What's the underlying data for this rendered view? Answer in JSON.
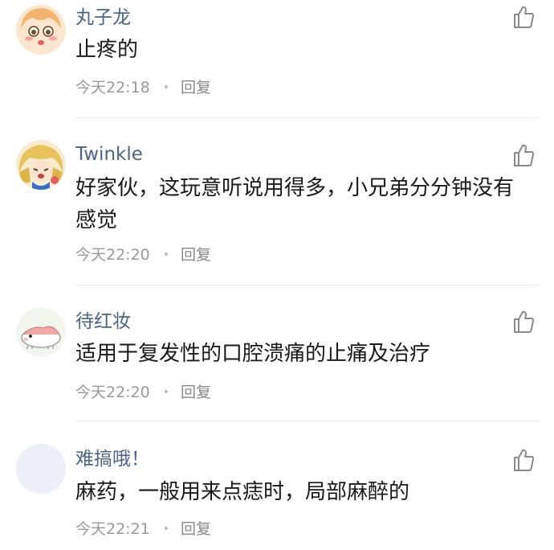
{
  "comments": [
    {
      "name": "丸子龙",
      "text": "止疼的",
      "time": "今天22:18",
      "reply": "回复",
      "avatar": "anime-girl-blush-avatar"
    },
    {
      "name": "Twinkle",
      "text": "好家伙，这玩意听说用得多，小兄弟分分钟没有感觉",
      "time": "今天22:20",
      "reply": "回复",
      "avatar": "anime-blonde-girl-avatar"
    },
    {
      "name": "待红妆",
      "text": "适用于复发性的口腔溃痛的止痛及治疗",
      "time": "今天22:20",
      "reply": "回复",
      "avatar": "hamster-avatar"
    },
    {
      "name": "难搞哦！",
      "text": "麻药，一般用来点痣时，局部麻醉的",
      "time": "今天22:21",
      "reply": "回复",
      "avatar": "default-avatar"
    }
  ],
  "icons": {
    "like": "thumbs-up-icon"
  },
  "colors": {
    "name": "#4a6487",
    "text": "#1a1a1a",
    "meta": "#999999",
    "divider": "#ececec"
  }
}
